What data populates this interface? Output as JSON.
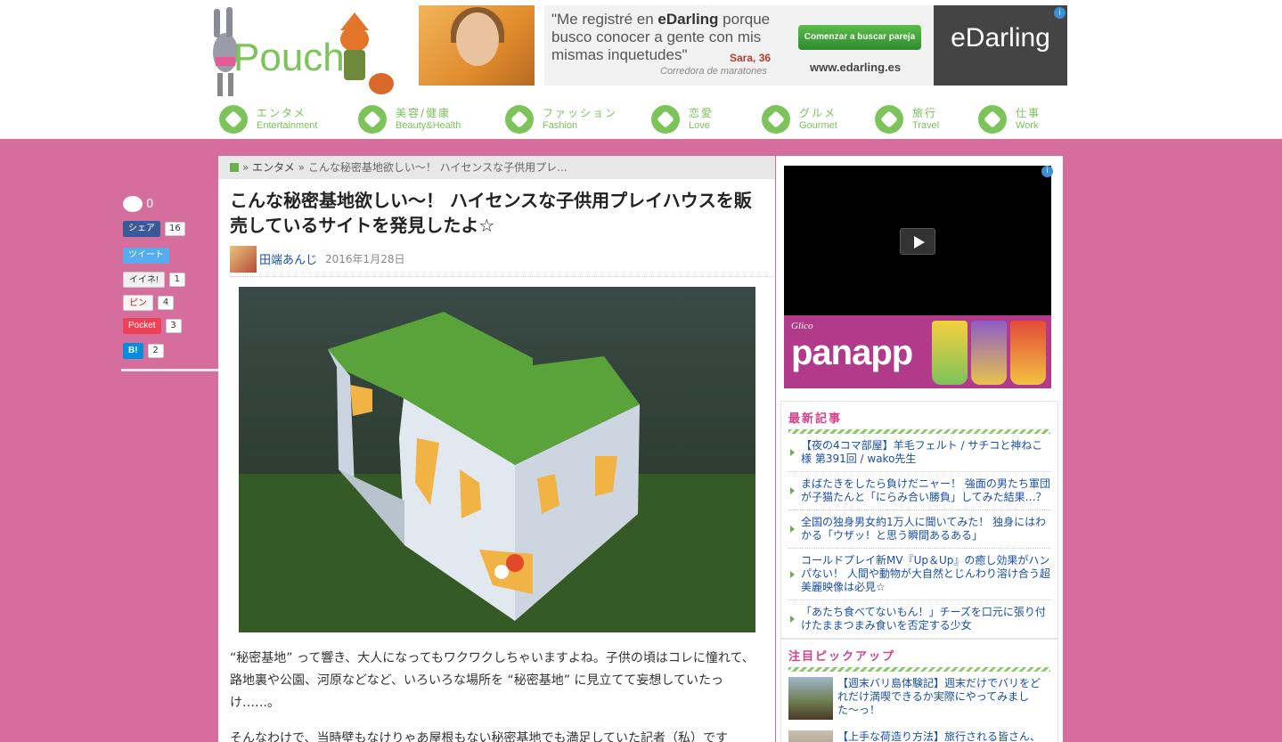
{
  "header": {
    "logo_text": "Pouch",
    "ad": {
      "quote_prefix": "\"Me registré en ",
      "quote_brand": "eDarling",
      "quote_suffix": " porque busco conocer a gente con mis mismas inquetudes\"",
      "person": "Sara, 36",
      "person_role": "Corredora de maratones",
      "cta": "Comenzar a buscar pareja",
      "url": "www.edarling.es",
      "brand": "eDarling",
      "info": "i"
    },
    "nav": [
      {
        "jp": "エンタメ",
        "en": "Entertainment"
      },
      {
        "jp": "美容/健康",
        "en": "Beauty&Health"
      },
      {
        "jp": "ファッション",
        "en": "Fashion"
      },
      {
        "jp": "恋愛",
        "en": "Love"
      },
      {
        "jp": "グルメ",
        "en": "Gourmet"
      },
      {
        "jp": "旅行",
        "en": "Travel"
      },
      {
        "jp": "仕事",
        "en": "Work"
      }
    ]
  },
  "social": {
    "comments": "0",
    "buttons": [
      {
        "label": "シェア",
        "count": "16",
        "color": "#3b5998"
      },
      {
        "label": "ツイート",
        "count": "",
        "color": "#55acee"
      },
      {
        "label": "イイネ!",
        "count": "1",
        "color": "#f0f0f0"
      },
      {
        "label": "ピン",
        "count": "4",
        "color": "#f5f5f5"
      },
      {
        "label": "Pocket",
        "count": "3",
        "color": "#ee4056"
      },
      {
        "label": "B!",
        "count": "2",
        "color": "#008fde"
      }
    ]
  },
  "article": {
    "breadcrumb_sep1": "»",
    "breadcrumb_cat": "エンタメ",
    "breadcrumb_sep2": "»",
    "breadcrumb_current": "こんな秘密基地欲しい〜！ ハイセンスな子供用プレ...",
    "title": "こんな秘密基地欲しい〜！ ハイセンスな子供用プレイハウスを販売しているサイトを発見したよ☆",
    "author": "田端あんじ",
    "date": "2016年1月28日",
    "paragraph1": "“秘密基地” って響き、大人になってもワクワクしちゃいますよね。子供の頃はコレに憧れて、路地裏や公園、河原などなど、いろいろな場所を “秘密基地” に見立てて妄想していたっけ……。",
    "paragraph2": "そんなわけで、当時壁もなけりゃあ屋根もない秘密基地でも満足していた記者（私）です"
  },
  "sidebar": {
    "ad_brand_small": "Glico",
    "ad_brand": "panapp",
    "latest_title": "最新記事",
    "latest": [
      "【夜の4コマ部屋】羊毛フェルト / サチコと神ねこ様 第391回 / wako先生",
      "まばたきをしたら負けだニャー！ 強面の男たち軍団が子猫たんと「にらみ合い勝負」してみた結果…？",
      "全国の独身男女約1万人に聞いてみた！ 独身にはわかる「ウザッ！と思う瞬間あるある」",
      "コールドプレイ新MV『Up＆Up』の癒し効果がハンパない！ 人間や動物が大自然とじんわり溶け合う超美麗映像は必見☆",
      "「あたち食べてないもん！」チーズを口元に張り付けたままつまみ食いを否定する少女"
    ],
    "pickup_title": "注目ピックアップ",
    "pickup": [
      "【週末バリ島体験記】週末だけでバリをどれだけ満喫できるか実際にやってみました〜っ！",
      "【上手な荷造り方法】旅行される皆さん、"
    ]
  }
}
